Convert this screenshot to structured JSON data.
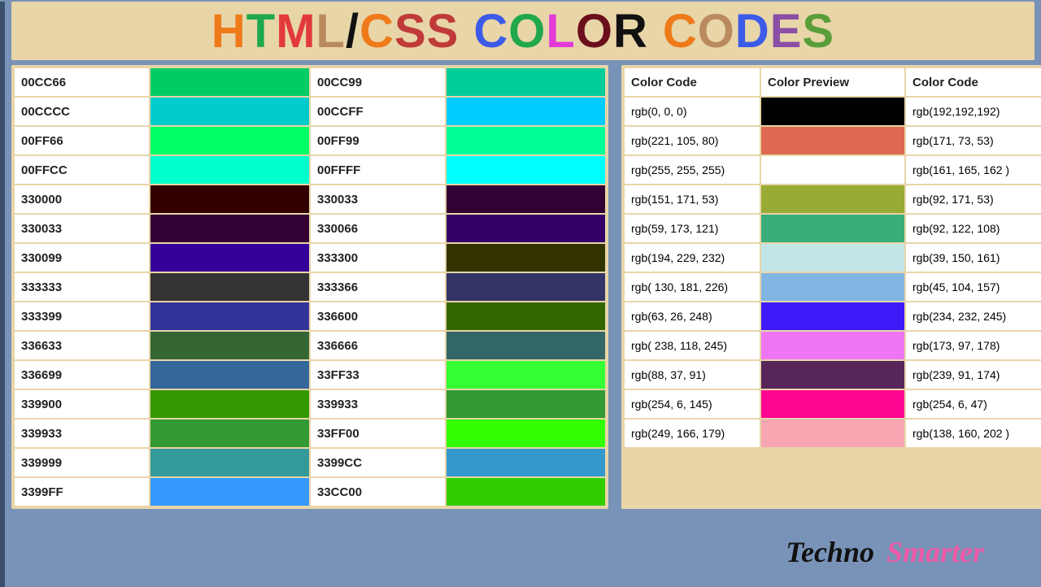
{
  "title_letters": [
    {
      "ch": "H",
      "color": "#ef7a1a"
    },
    {
      "ch": "T",
      "color": "#1fa84c"
    },
    {
      "ch": "M",
      "color": "#e23a3a"
    },
    {
      "ch": "L",
      "color": "#ba8a5f"
    },
    {
      "ch": "/",
      "color": "#111"
    },
    {
      "ch": "C",
      "color": "#ef7a1a"
    },
    {
      "ch": "S",
      "color": "#c03a3a"
    },
    {
      "ch": "S",
      "color": "#c03a3a"
    },
    {
      "ch": " ",
      "color": "#000"
    },
    {
      "ch": "C",
      "color": "#3c5be8"
    },
    {
      "ch": "O",
      "color": "#1fa84c"
    },
    {
      "ch": "L",
      "color": "#e23ad8"
    },
    {
      "ch": "O",
      "color": "#6a0f1b"
    },
    {
      "ch": "R",
      "color": "#111"
    },
    {
      "ch": " ",
      "color": "#000"
    },
    {
      "ch": "C",
      "color": "#ef7a1a"
    },
    {
      "ch": "O",
      "color": "#ba8a5f"
    },
    {
      "ch": "D",
      "color": "#3c5be8"
    },
    {
      "ch": "E",
      "color": "#8a4ea6"
    },
    {
      "ch": "S",
      "color": "#5a9e3a"
    }
  ],
  "hex_rows": [
    {
      "c1": "00CC66",
      "s1": "#00CC66",
      "c2": "00CC99",
      "s2": "#00CC99"
    },
    {
      "c1": "00CCCC",
      "s1": "#00CCCC",
      "c2": "00CCFF",
      "s2": "#00CCFF"
    },
    {
      "c1": "00FF66",
      "s1": "#00FF66",
      "c2": "00FF99",
      "s2": "#00FF99"
    },
    {
      "c1": "00FFCC",
      "s1": "#00FFCC",
      "c2": "00FFFF",
      "s2": "#00FFFF"
    },
    {
      "c1": "330000",
      "s1": "#330000",
      "c2": "330033",
      "s2": "#330033"
    },
    {
      "c1": "330033",
      "s1": "#330033",
      "c2": "330066",
      "s2": "#330066"
    },
    {
      "c1": "330099",
      "s1": "#330099",
      "c2": "333300",
      "s2": "#333300"
    },
    {
      "c1": "333333",
      "s1": "#333333",
      "c2": "333366",
      "s2": "#333366"
    },
    {
      "c1": "333399",
      "s1": "#333399",
      "c2": "336600",
      "s2": "#336600"
    },
    {
      "c1": "336633",
      "s1": "#336633",
      "c2": "336666",
      "s2": "#336666"
    },
    {
      "c1": "336699",
      "s1": "#336699",
      "c2": "33FF33",
      "s2": "#33FF33"
    },
    {
      "c1": "339900",
      "s1": "#339900",
      "c2": "339933",
      "s2": "#339933"
    },
    {
      "c1": "339933",
      "s1": "#339933",
      "c2": "33FF00",
      "s2": "#33FF00"
    },
    {
      "c1": "339999",
      "s1": "#339999",
      "c2": "3399CC",
      "s2": "#3399CC"
    },
    {
      "c1": "3399FF",
      "s1": "#3399FF",
      "c2": "33CC00",
      "s2": "#33CC00"
    }
  ],
  "rgb_headers": {
    "h1": "Color Code",
    "h2": "Color Preview",
    "h3": "Color Code"
  },
  "rgb_rows": [
    {
      "c1": "rgb(0, 0, 0)",
      "s": "rgb(0,0,0)",
      "c2": "rgb(192,192,192)"
    },
    {
      "c1": "rgb(221, 105, 80)",
      "s": "rgb(221,105,80)",
      "c2": "rgb(171, 73, 53)"
    },
    {
      "c1": "rgb(255, 255, 255)",
      "s": "rgb(255,255,255)",
      "c2": "rgb(161, 165, 162 )"
    },
    {
      "c1": "rgb(151, 171, 53)",
      "s": "rgb(151,171,53)",
      "c2": "rgb(92, 171, 53)"
    },
    {
      "c1": "rgb(59, 173, 121)",
      "s": "rgb(59,173,121)",
      "c2": "rgb(92, 122, 108)"
    },
    {
      "c1": "rgb(194, 229, 232)",
      "s": "rgb(194,229,232)",
      "c2": "rgb(39, 150, 161)"
    },
    {
      "c1": "rgb( 130, 181, 226)",
      "s": "rgb(130,181,226)",
      "c2": "rgb(45, 104, 157)"
    },
    {
      "c1": "rgb(63, 26, 248)",
      "s": "rgb(63,26,248)",
      "c2": "rgb(234, 232, 245)"
    },
    {
      "c1": "rgb( 238, 118, 245)",
      "s": "rgb(238,118,245)",
      "c2": "rgb(173, 97, 178)"
    },
    {
      "c1": "rgb(88, 37, 91)",
      "s": "rgb(88,37,91)",
      "c2": "rgb(239, 91, 174)"
    },
    {
      "c1": "rgb(254, 6, 145)",
      "s": "rgb(254,6,145)",
      "c2": "rgb(254, 6, 47)"
    },
    {
      "c1": "rgb(249, 166, 179)",
      "s": "rgb(249,166,179)",
      "c2": "rgb(138, 160, 202 )"
    }
  ],
  "footer": {
    "p1": "Techno",
    "p2": "Smarter"
  }
}
